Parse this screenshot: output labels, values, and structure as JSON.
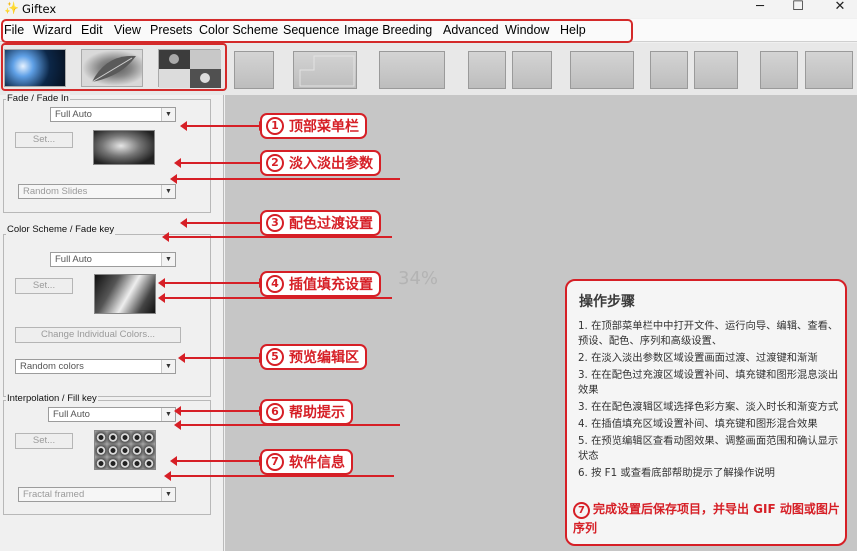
{
  "window": {
    "title": "Giftex",
    "app_icon": "✨",
    "minimize": "─",
    "maximize": "☐",
    "close": "✕"
  },
  "menu": [
    "File",
    "Wizard",
    "Edit",
    "View",
    "Presets",
    "Color Scheme",
    "Sequence",
    "Image Breeding",
    "Advanced",
    "Window",
    "Help"
  ],
  "panel": {
    "fade": {
      "title": "Fade / Fade In",
      "mode": "Full Auto",
      "set_label": "Set...",
      "effect": "Random Slides"
    },
    "color": {
      "title": "Color Scheme / Fade key",
      "mode": "Full Auto",
      "set_label": "Set...",
      "change_colors": "Change Individual Colors...",
      "palette": "Random colors"
    },
    "interp": {
      "title": "Interpolation / Fill key",
      "mode": "Full Auto",
      "set_label": "Set...",
      "shape": "Fractal framed"
    }
  },
  "canvas": {
    "progress_label": "34%"
  },
  "callouts": [
    {
      "num": "1",
      "text": "顶部菜单栏"
    },
    {
      "num": "2",
      "text": "淡入淡出参数"
    },
    {
      "num": "3",
      "text": "配色过渡设置"
    },
    {
      "num": "4",
      "text": "插值填充设置"
    },
    {
      "num": "5",
      "text": "预览编辑区"
    },
    {
      "num": "6",
      "text": "帮助提示"
    },
    {
      "num": "7",
      "text": "软件信息"
    }
  ],
  "steps": {
    "title": "操作步骤",
    "items": [
      "1. 在顶部菜单栏中中打开文件、运行向导、编辑、查看、预设、配色、序列和高级设置、",
      "2. 在淡入淡出参数区域设置画面过渡、过渡键和渐渐",
      "3. 在在配色过充渡区域设置补间、填充键和图形混息淡出效果",
      "3. 在在配色渡辑区域选择色彩方案、淡入时长和渐变方式",
      "4. 在插值填充区域设置补间、填充键和图形混合效果",
      "5. 在预览编辑区查看动图效果、调整画面范围和确认显示状态",
      "6. 按 F1 或查看底部帮助提示了解操作说明"
    ],
    "final_num": "7",
    "final_text": "完成设置后保存项目，并导出 GIF 动图或图片序列"
  },
  "colors": {
    "accent_red": "#d61f26",
    "canvas_gray": "#c6c6c6"
  }
}
